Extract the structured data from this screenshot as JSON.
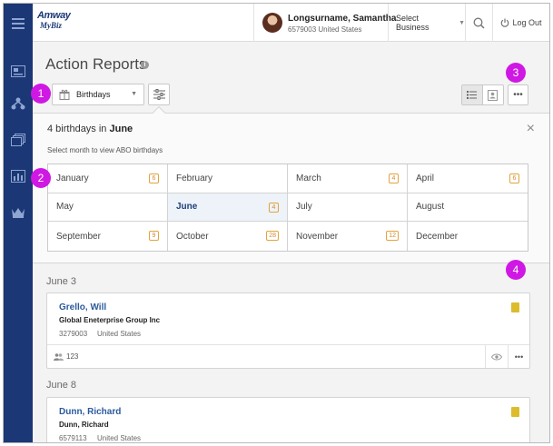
{
  "app": {
    "logo_line1": "Amway",
    "logo_line2": "MyBiz"
  },
  "user": {
    "name": "Longsurname, Samantha",
    "id_country": "6579003 United States"
  },
  "topbar": {
    "business_label": "Select Business",
    "logout_label": "Log Out"
  },
  "page": {
    "title": "Action Reports",
    "info_glyph": "i",
    "report_type": "Birthdays",
    "more_glyph": "•••"
  },
  "birthdays": {
    "count_text": "4 birthdays in ",
    "selected_month": "June",
    "subtitle": "Select month to view ABO birthdays",
    "close_glyph": "×",
    "months": [
      {
        "name": "January",
        "count": "6"
      },
      {
        "name": "February",
        "count": ""
      },
      {
        "name": "March",
        "count": "4"
      },
      {
        "name": "April",
        "count": "6"
      },
      {
        "name": "May",
        "count": ""
      },
      {
        "name": "June",
        "count": "4"
      },
      {
        "name": "July",
        "count": ""
      },
      {
        "name": "August",
        "count": ""
      },
      {
        "name": "September",
        "count": "9"
      },
      {
        "name": "October",
        "count": "28"
      },
      {
        "name": "November",
        "count": "12"
      },
      {
        "name": "December",
        "count": ""
      }
    ]
  },
  "list": {
    "groups": [
      {
        "date": "June 3",
        "name": "Grello, Will",
        "org": "Global Eneterprise Group Inc",
        "abo_id": "3279003",
        "country": "United States",
        "people_count": "123",
        "flag_color": "#dcbc2d"
      },
      {
        "date": "June 8",
        "name": "Dunn, Richard",
        "org": "Dunn, Richard",
        "abo_id": "6579113",
        "country": "United States",
        "flag_color": "#dcbc2d"
      }
    ]
  },
  "callouts": [
    "1",
    "2",
    "3",
    "4"
  ],
  "colors": {
    "rail": "#1b3775",
    "link": "#2b5a9c",
    "callout": "#cf18e3",
    "count_badge": "#e3a33d",
    "flag": "#dcbc2d"
  },
  "icons": {
    "rail": [
      "hamburger-icon",
      "card-icon",
      "network-icon",
      "layers-icon",
      "bar-chart-icon",
      "crown-icon"
    ],
    "toolbar": [
      "gift-icon",
      "sliders-icon",
      "list-view-icon",
      "card-view-icon"
    ],
    "topbar": [
      "search-icon",
      "power-icon"
    ]
  }
}
